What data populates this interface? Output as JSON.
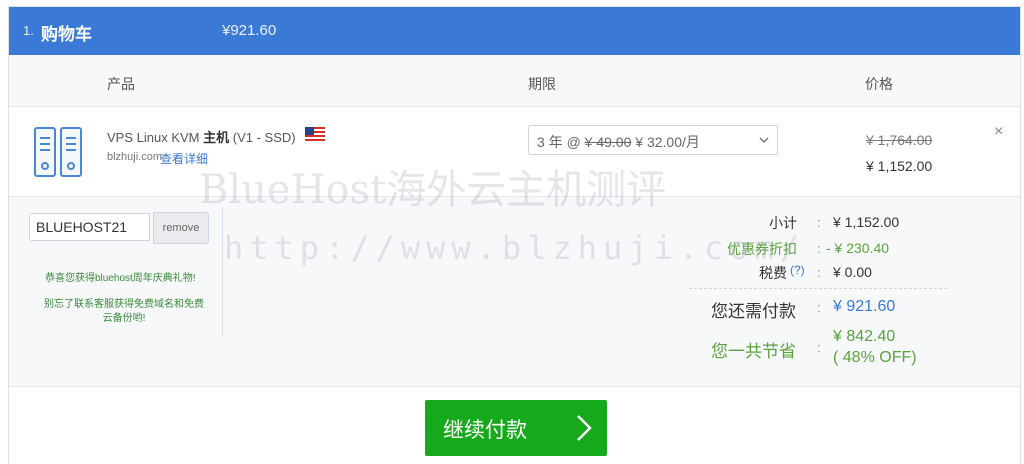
{
  "header": {
    "step": "1.",
    "title": "购物车",
    "total": "¥921.60"
  },
  "columns": {
    "product": "产品",
    "period": "期限",
    "price": "价格"
  },
  "item": {
    "name_prefix": "VPS Linux KVM ",
    "name_bold": "主机",
    "name_suffix": " (V1 - SSD)",
    "flag_icon": "us-flag-icon",
    "domain": "blzhuji.com",
    "detail_link": "查看详细",
    "period_prefix": "3 年 @ ",
    "period_old": "¥ 49.00",
    "period_new": " ¥ 32.00/月",
    "price_old": "¥ 1,764.00",
    "price_new": "¥ 1,152.00",
    "close_icon": "×"
  },
  "coupon": {
    "code": "BLUEHOST21",
    "remove_label": "remove",
    "promo1": "恭喜您获得bluehost周年庆典礼物!",
    "promo2": "别忘了联系客服获得免费域名和免费云备份哟!"
  },
  "totals": {
    "subtotal_label": "小计",
    "subtotal_value": "¥ 1,152.00",
    "discount_label": "优惠券折扣",
    "discount_value": "- ¥ 230.40",
    "tax_label": "税费",
    "tax_help": "(?)",
    "tax_value": "¥ 0.00",
    "due_label": "您还需付款",
    "due_value": "¥ 921.60",
    "saved_label": "您一共节省",
    "saved_value": "¥ 842.40",
    "saved_percent": "( 48% OFF)",
    "colon": ":"
  },
  "checkout_label": "继续付款",
  "watermark": {
    "line1": "BlueHost海外云主机测评",
    "line2": "http://www.blzhuji.com/"
  },
  "colors": {
    "header": "#3a79d6",
    "checkout": "#17a91c",
    "green_text": "#5aa33c",
    "blue_text": "#3a79d6"
  }
}
